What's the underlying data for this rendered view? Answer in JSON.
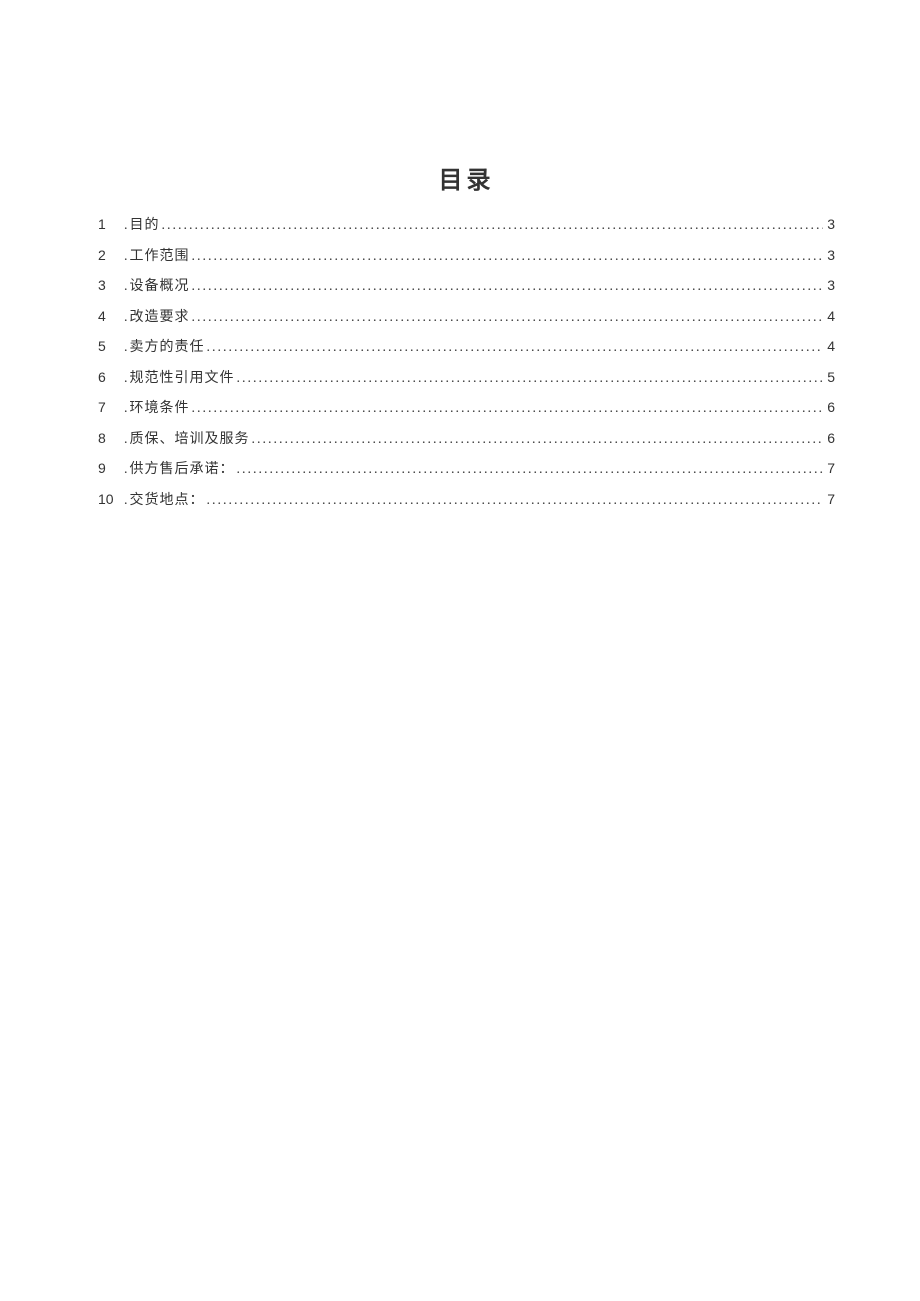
{
  "toc": {
    "title": "目录",
    "entries": [
      {
        "num": "1",
        "text": "目的",
        "page": "3"
      },
      {
        "num": "2",
        "text": "工作范围",
        "page": "3"
      },
      {
        "num": "3",
        "text": "设备概况",
        "page": "3"
      },
      {
        "num": "4",
        "text": "改造要求",
        "page": "4"
      },
      {
        "num": "5",
        "text": "卖方的责任",
        "page": "4"
      },
      {
        "num": "6",
        "text": "规范性引用文件",
        "page": "5"
      },
      {
        "num": "7",
        "text": "环境条件",
        "page": "6"
      },
      {
        "num": "8",
        "text": "质保、培训及服务",
        "page": "6"
      },
      {
        "num": "9",
        "text": " 供方售后承诺：",
        "page": "7"
      },
      {
        "num": "10",
        "text": "交货地点：",
        "page": "7"
      }
    ]
  }
}
